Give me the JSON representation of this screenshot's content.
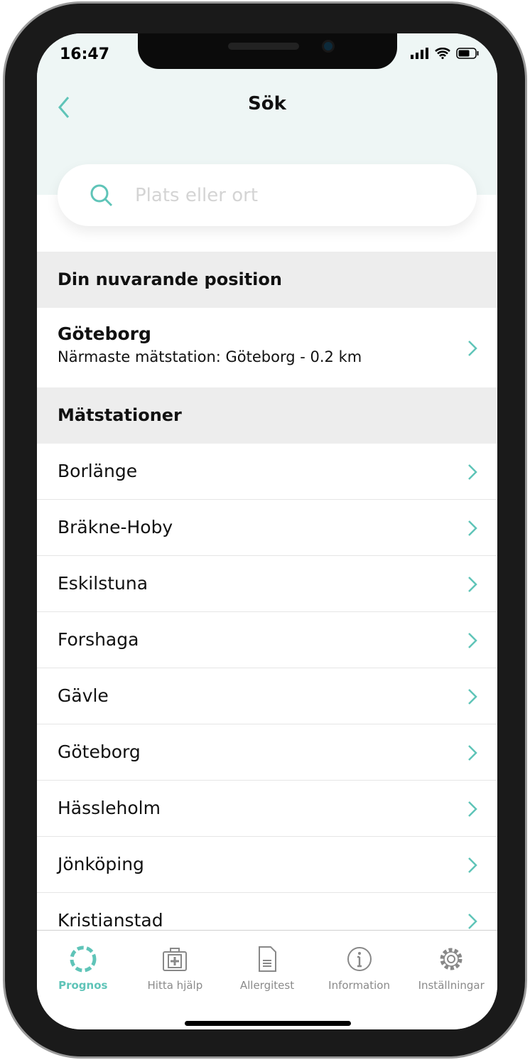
{
  "status": {
    "time": "16:47"
  },
  "header": {
    "title": "Sök"
  },
  "search": {
    "placeholder": "Plats eller ort",
    "value": ""
  },
  "current": {
    "section_title": "Din nuvarande position",
    "name": "Göteborg",
    "subtitle": "Närmaste mätstation: Göteborg - 0.2 km"
  },
  "stations": {
    "section_title": "Mätstationer",
    "items": [
      "Borlänge",
      "Bräkne-Hoby",
      "Eskilstuna",
      "Forshaga",
      "Gävle",
      "Göteborg",
      "Hässleholm",
      "Jönköping",
      "Kristianstad"
    ]
  },
  "tabs": [
    {
      "label": "Prognos",
      "icon": "dashed-circle-icon"
    },
    {
      "label": "Hitta hjälp",
      "icon": "first-aid-kit-icon"
    },
    {
      "label": "Allergitest",
      "icon": "document-icon"
    },
    {
      "label": "Information",
      "icon": "info-icon"
    },
    {
      "label": "Inställningar",
      "icon": "gear-icon"
    }
  ],
  "colors": {
    "accent": "#5fc4b8",
    "header_bg": "#eef6f5",
    "section_bg": "#ededed"
  }
}
